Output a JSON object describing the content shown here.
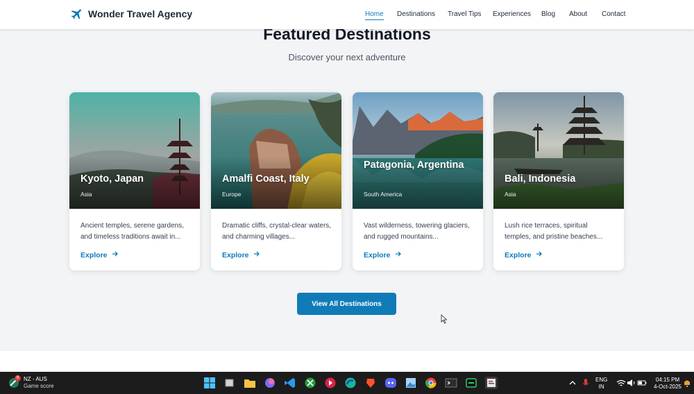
{
  "header": {
    "brand": "Wonder Travel Agency",
    "nav": [
      {
        "label": "Home",
        "active": true
      },
      {
        "label": "Destinations",
        "active": false
      },
      {
        "label": "Travel Tips",
        "active": false
      },
      {
        "label": "Experiences",
        "active": false
      },
      {
        "label": "Blog",
        "active": false
      },
      {
        "label": "About",
        "active": false
      },
      {
        "label": "Contact",
        "active": false
      }
    ]
  },
  "section": {
    "title": "Featured Destinations",
    "subtitle": "Discover your next adventure"
  },
  "cards": [
    {
      "title": "Kyoto, Japan",
      "region": "Asia",
      "description": "Ancient temples, serene gardens, and timeless traditions await in...",
      "cta": "Explore"
    },
    {
      "title": "Amalfi Coast, Italy",
      "region": "Europe",
      "description": "Dramatic cliffs, crystal-clear waters, and charming villages...",
      "cta": "Explore"
    },
    {
      "title": "Patagonia, Argentina",
      "region": "South America",
      "description": "Vast wilderness, towering glaciers, and rugged mountains...",
      "cta": "Explore"
    },
    {
      "title": "Bali, Indonesia",
      "region": "Asia",
      "description": "Lush rice terraces, spiritual temples, and pristine beaches...",
      "cta": "Explore"
    }
  ],
  "view_all_label": "View All Destinations",
  "colors": {
    "accent": "#0e7ab9",
    "button": "#117bb8",
    "background": "#f3f4f6"
  },
  "taskbar": {
    "weather_title": "NZ - AUS",
    "weather_sub": "Game score",
    "badge": "9",
    "lang_line1": "ENG",
    "lang_line2": "IN",
    "time": "04:15 PM",
    "date": "4-Oct-2025"
  }
}
